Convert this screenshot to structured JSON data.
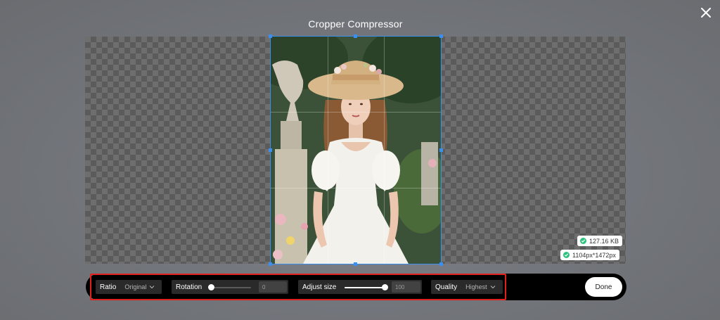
{
  "dialog": {
    "title": "Cropper Compressor",
    "close_icon": "close-icon"
  },
  "image_info": {
    "file_size": "127.16 KB",
    "dimensions": "1104px*1472px",
    "check_icon": "check-circle-icon",
    "badge_color": "#2ec27e"
  },
  "toolbar": {
    "ratio_label": "Ratio",
    "ratio_value": "Original",
    "rotation_label": "Rotation",
    "rotation_value": "0",
    "rotation_fraction": 0,
    "adjust_label": "Adjust size",
    "adjust_value": "100",
    "adjust_fraction": 1.0,
    "quality_label": "Quality",
    "quality_value": "Highest",
    "done_label": "Done",
    "highlight_color": "#e0201c",
    "crop_color": "#3a8ff0"
  }
}
